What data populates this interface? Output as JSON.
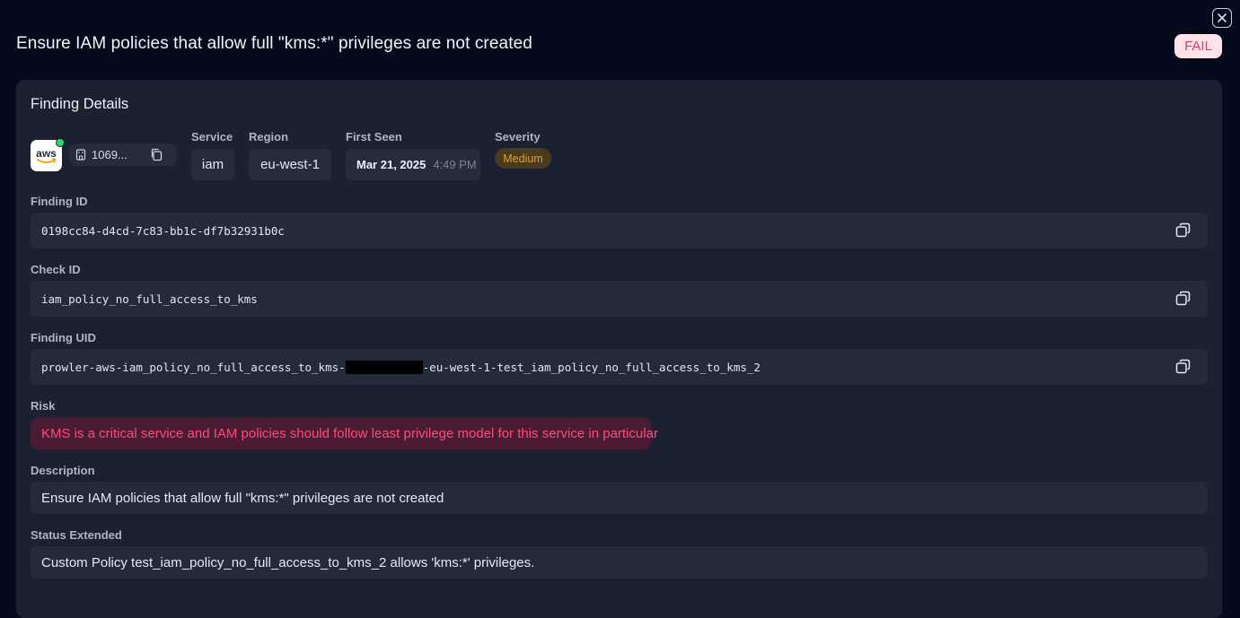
{
  "header": {
    "title": "Ensure IAM policies that allow full \"kms:*\" privileges are not created",
    "status": "FAIL"
  },
  "card": {
    "title": "Finding Details",
    "provider": {
      "logo_text": "aws",
      "account": "1069..."
    },
    "service": {
      "label": "Service",
      "value": "iam"
    },
    "region": {
      "label": "Region",
      "value": "eu-west-1"
    },
    "first_seen": {
      "label": "First Seen",
      "date": "Mar 21, 2025",
      "time": "4:49 PM"
    },
    "severity": {
      "label": "Severity",
      "value": "Medium"
    },
    "finding_id": {
      "label": "Finding ID",
      "value": "0198cc84-d4cd-7c83-bb1c-df7b32931b0c"
    },
    "check_id": {
      "label": "Check ID",
      "value": "iam_policy_no_full_access_to_kms"
    },
    "finding_uid": {
      "label": "Finding UID",
      "prefix": "prowler-aws-iam_policy_no_full_access_to_kms-",
      "suffix": "-eu-west-1-test_iam_policy_no_full_access_to_kms_2"
    },
    "risk": {
      "label": "Risk",
      "value": "KMS is a critical service and IAM policies should follow least privilege model for this service in particular"
    },
    "description": {
      "label": "Description",
      "value": "Ensure IAM policies that allow full \"kms:*\" privileges are not created"
    },
    "status_extended": {
      "label": "Status Extended",
      "value": "Custom Policy test_iam_policy_no_full_access_to_kms_2 allows 'kms:*' privileges."
    }
  },
  "colors": {
    "background": "#050b1c",
    "card": "#1b2130",
    "fail_text": "#e4366b",
    "fail_bg": "#fde3e9",
    "severity_medium": "#e0a030",
    "risk_text": "#ff4a7e",
    "online_dot": "#2fd96a"
  },
  "icons": {
    "close": "close-icon",
    "account": "building-icon",
    "copy": "copy-icon"
  }
}
